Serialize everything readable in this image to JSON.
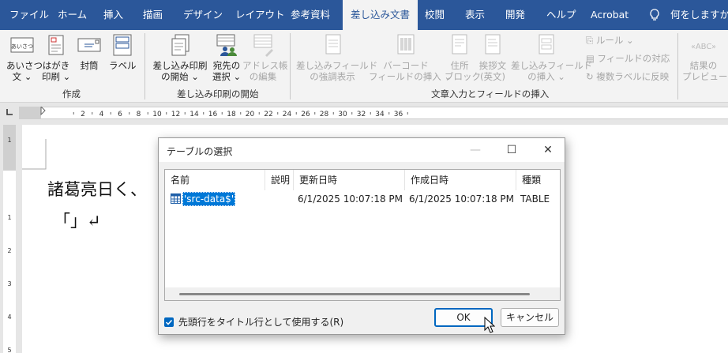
{
  "tabs": [
    "ファイル",
    "ホーム",
    "挿入",
    "描画",
    "デザイン",
    "レイアウト",
    "参考資料",
    "差し込み文書",
    "校閲",
    "表示",
    "開発",
    "ヘルプ",
    "Acrobat"
  ],
  "tell_me": "何をしますか",
  "ribbon": {
    "create_group": {
      "label": "作成",
      "buttons": [
        {
          "line1": "あいさつ",
          "line2": "文 ⌄"
        },
        {
          "line1": "はがき",
          "line2": "印刷 ⌄"
        },
        {
          "line1": "封筒",
          "line2": ""
        },
        {
          "line1": "ラベル",
          "line2": ""
        }
      ]
    },
    "start_group": {
      "label": "差し込み印刷の開始",
      "buttons": [
        {
          "line1": "差し込み印刷",
          "line2": "の開始 ⌄"
        },
        {
          "line1": "宛先の",
          "line2": "選択 ⌄"
        },
        {
          "line1": "アドレス帳",
          "line2": "の編集"
        }
      ]
    },
    "fields_group": {
      "label": "文章入力とフィールドの挿入",
      "buttons": [
        {
          "line1": "差し込みフィールド",
          "line2": "の強調表示"
        },
        {
          "line1": "バーコード",
          "line2": "フィールドの挿入 ⌄"
        },
        {
          "line1": "住所",
          "line2": "ブロック"
        },
        {
          "line1": "挨拶文",
          "line2": "(英文)"
        },
        {
          "line1": "差し込みフィールド",
          "line2": "の挿入 ⌄"
        }
      ],
      "small_buttons": [
        "ルール ⌄",
        "フィールドの対応",
        "複数ラベルに反映"
      ]
    },
    "preview_group": {
      "line1": "結果の",
      "line2": "プレビュー"
    }
  },
  "ruler": {
    "numbers": [
      "2",
      "4",
      "6",
      "8",
      "10",
      "12",
      "14",
      "16",
      "18",
      "20",
      "22",
      "24",
      "26",
      "28",
      "30",
      "32",
      "34",
      "36"
    ],
    "vnumbers": [
      "1",
      "1",
      "2",
      "3",
      "4",
      "5"
    ]
  },
  "document": {
    "line1": "諸葛亮日く、",
    "line2": "「」↵"
  },
  "dialog": {
    "title": "テーブルの選択",
    "columns": [
      "名前",
      "説明",
      "更新日時",
      "作成日時",
      "種類"
    ],
    "rows": [
      {
        "name": "'src-data$'",
        "description": "",
        "modified": "6/1/2025 10:07:18 PM",
        "created": "6/1/2025 10:07:18 PM",
        "type": "TABLE"
      }
    ],
    "checkbox_label": "先頭行をタイトル行として使用する(R)",
    "checkbox_checked": true,
    "ok_label": "OK",
    "cancel_label": "キャンセル",
    "minimize": "—",
    "maximize": "☐",
    "close": "✕"
  },
  "colors": {
    "accent": "#2b579a",
    "selection": "#0078d7"
  }
}
